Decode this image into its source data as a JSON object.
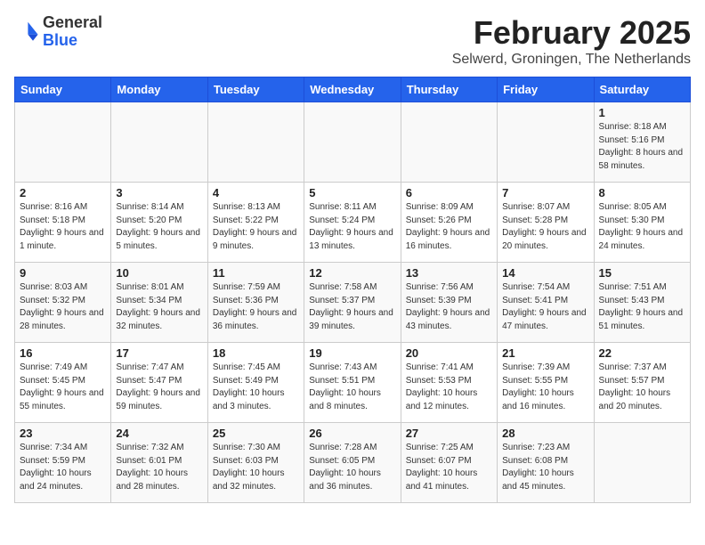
{
  "header": {
    "logo_general": "General",
    "logo_blue": "Blue",
    "month_year": "February 2025",
    "location": "Selwerd, Groningen, The Netherlands"
  },
  "days_of_week": [
    "Sunday",
    "Monday",
    "Tuesday",
    "Wednesday",
    "Thursday",
    "Friday",
    "Saturday"
  ],
  "weeks": [
    [
      {
        "day": "",
        "info": ""
      },
      {
        "day": "",
        "info": ""
      },
      {
        "day": "",
        "info": ""
      },
      {
        "day": "",
        "info": ""
      },
      {
        "day": "",
        "info": ""
      },
      {
        "day": "",
        "info": ""
      },
      {
        "day": "1",
        "info": "Sunrise: 8:18 AM\nSunset: 5:16 PM\nDaylight: 8 hours and 58 minutes."
      }
    ],
    [
      {
        "day": "2",
        "info": "Sunrise: 8:16 AM\nSunset: 5:18 PM\nDaylight: 9 hours and 1 minute."
      },
      {
        "day": "3",
        "info": "Sunrise: 8:14 AM\nSunset: 5:20 PM\nDaylight: 9 hours and 5 minutes."
      },
      {
        "day": "4",
        "info": "Sunrise: 8:13 AM\nSunset: 5:22 PM\nDaylight: 9 hours and 9 minutes."
      },
      {
        "day": "5",
        "info": "Sunrise: 8:11 AM\nSunset: 5:24 PM\nDaylight: 9 hours and 13 minutes."
      },
      {
        "day": "6",
        "info": "Sunrise: 8:09 AM\nSunset: 5:26 PM\nDaylight: 9 hours and 16 minutes."
      },
      {
        "day": "7",
        "info": "Sunrise: 8:07 AM\nSunset: 5:28 PM\nDaylight: 9 hours and 20 minutes."
      },
      {
        "day": "8",
        "info": "Sunrise: 8:05 AM\nSunset: 5:30 PM\nDaylight: 9 hours and 24 minutes."
      }
    ],
    [
      {
        "day": "9",
        "info": "Sunrise: 8:03 AM\nSunset: 5:32 PM\nDaylight: 9 hours and 28 minutes."
      },
      {
        "day": "10",
        "info": "Sunrise: 8:01 AM\nSunset: 5:34 PM\nDaylight: 9 hours and 32 minutes."
      },
      {
        "day": "11",
        "info": "Sunrise: 7:59 AM\nSunset: 5:36 PM\nDaylight: 9 hours and 36 minutes."
      },
      {
        "day": "12",
        "info": "Sunrise: 7:58 AM\nSunset: 5:37 PM\nDaylight: 9 hours and 39 minutes."
      },
      {
        "day": "13",
        "info": "Sunrise: 7:56 AM\nSunset: 5:39 PM\nDaylight: 9 hours and 43 minutes."
      },
      {
        "day": "14",
        "info": "Sunrise: 7:54 AM\nSunset: 5:41 PM\nDaylight: 9 hours and 47 minutes."
      },
      {
        "day": "15",
        "info": "Sunrise: 7:51 AM\nSunset: 5:43 PM\nDaylight: 9 hours and 51 minutes."
      }
    ],
    [
      {
        "day": "16",
        "info": "Sunrise: 7:49 AM\nSunset: 5:45 PM\nDaylight: 9 hours and 55 minutes."
      },
      {
        "day": "17",
        "info": "Sunrise: 7:47 AM\nSunset: 5:47 PM\nDaylight: 9 hours and 59 minutes."
      },
      {
        "day": "18",
        "info": "Sunrise: 7:45 AM\nSunset: 5:49 PM\nDaylight: 10 hours and 3 minutes."
      },
      {
        "day": "19",
        "info": "Sunrise: 7:43 AM\nSunset: 5:51 PM\nDaylight: 10 hours and 8 minutes."
      },
      {
        "day": "20",
        "info": "Sunrise: 7:41 AM\nSunset: 5:53 PM\nDaylight: 10 hours and 12 minutes."
      },
      {
        "day": "21",
        "info": "Sunrise: 7:39 AM\nSunset: 5:55 PM\nDaylight: 10 hours and 16 minutes."
      },
      {
        "day": "22",
        "info": "Sunrise: 7:37 AM\nSunset: 5:57 PM\nDaylight: 10 hours and 20 minutes."
      }
    ],
    [
      {
        "day": "23",
        "info": "Sunrise: 7:34 AM\nSunset: 5:59 PM\nDaylight: 10 hours and 24 minutes."
      },
      {
        "day": "24",
        "info": "Sunrise: 7:32 AM\nSunset: 6:01 PM\nDaylight: 10 hours and 28 minutes."
      },
      {
        "day": "25",
        "info": "Sunrise: 7:30 AM\nSunset: 6:03 PM\nDaylight: 10 hours and 32 minutes."
      },
      {
        "day": "26",
        "info": "Sunrise: 7:28 AM\nSunset: 6:05 PM\nDaylight: 10 hours and 36 minutes."
      },
      {
        "day": "27",
        "info": "Sunrise: 7:25 AM\nSunset: 6:07 PM\nDaylight: 10 hours and 41 minutes."
      },
      {
        "day": "28",
        "info": "Sunrise: 7:23 AM\nSunset: 6:08 PM\nDaylight: 10 hours and 45 minutes."
      },
      {
        "day": "",
        "info": ""
      }
    ]
  ]
}
